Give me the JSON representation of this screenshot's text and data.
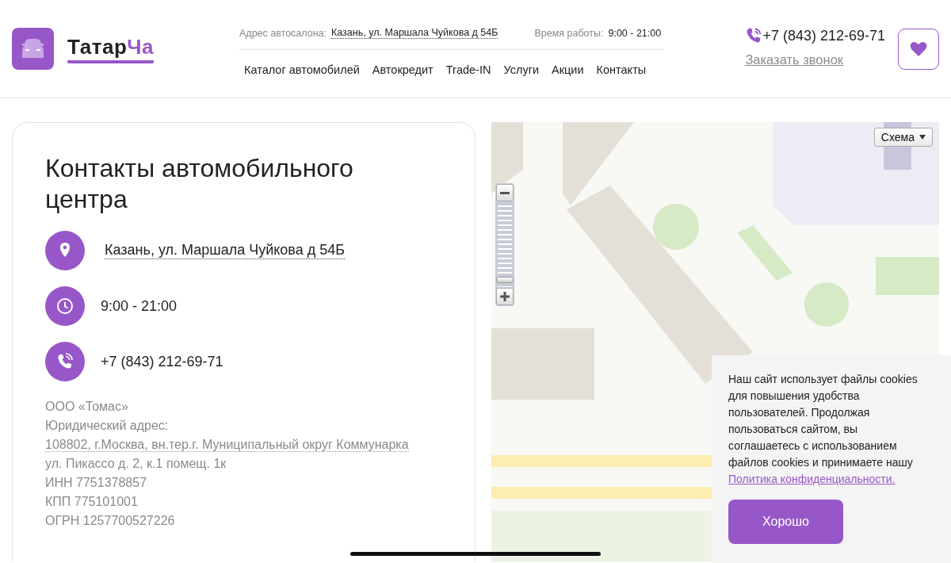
{
  "header": {
    "logo": {
      "dark": "Татар",
      "accent": "Ча"
    },
    "address_label": "Адрес автосалона:",
    "address": "Казань, ул. Маршала Чуйкова д 54Б",
    "hours_label": "Время работы:",
    "hours": "9:00 - 21:00",
    "nav": [
      {
        "label": "Каталог автомобилей"
      },
      {
        "label": "Автокредит"
      },
      {
        "label": "Trade-IN"
      },
      {
        "label": "Услуги"
      },
      {
        "label": "Акции"
      },
      {
        "label": "Контакты"
      }
    ],
    "phone": "+7 (843) 212-69-71",
    "callback": "Заказать звонок"
  },
  "contacts": {
    "title": "Контакты автомобильного центра",
    "items": [
      {
        "kind": "address",
        "text": "Казань, ул. Маршала Чуйкова д 54Б"
      },
      {
        "kind": "hours",
        "text": "9:00 - 21:00"
      },
      {
        "kind": "phone",
        "text": "+7 (843) 212-69-71"
      }
    ],
    "legal": [
      {
        "kind": "text",
        "text": "ООО «Томас»"
      },
      {
        "kind": "text",
        "text": "Юридический адрес:"
      },
      {
        "kind": "link",
        "text": "108802, г.Москва, вн.тер.г. Муниципальный округ Коммунарка"
      },
      {
        "kind": "text",
        "text": "ул. Пикассо д. 2, к.1 помещ. 1к"
      },
      {
        "kind": "text",
        "text": "ИНН 7751378857"
      },
      {
        "kind": "text",
        "text": "КПП 775101001"
      },
      {
        "kind": "text",
        "text": "ОГРН 1257700527226"
      }
    ]
  },
  "map": {
    "kind": "picture",
    "layer": "Схема"
  },
  "cookie": {
    "text": "Наш сайт использует файлы cookies для повышения удобства пользователей. Продолжая пользоваться сайтом, вы соглашаетесь с использованием файлов cookies и принимаете нашу",
    "link": "Политика конфиденциальности.",
    "button": "Хорошо"
  }
}
